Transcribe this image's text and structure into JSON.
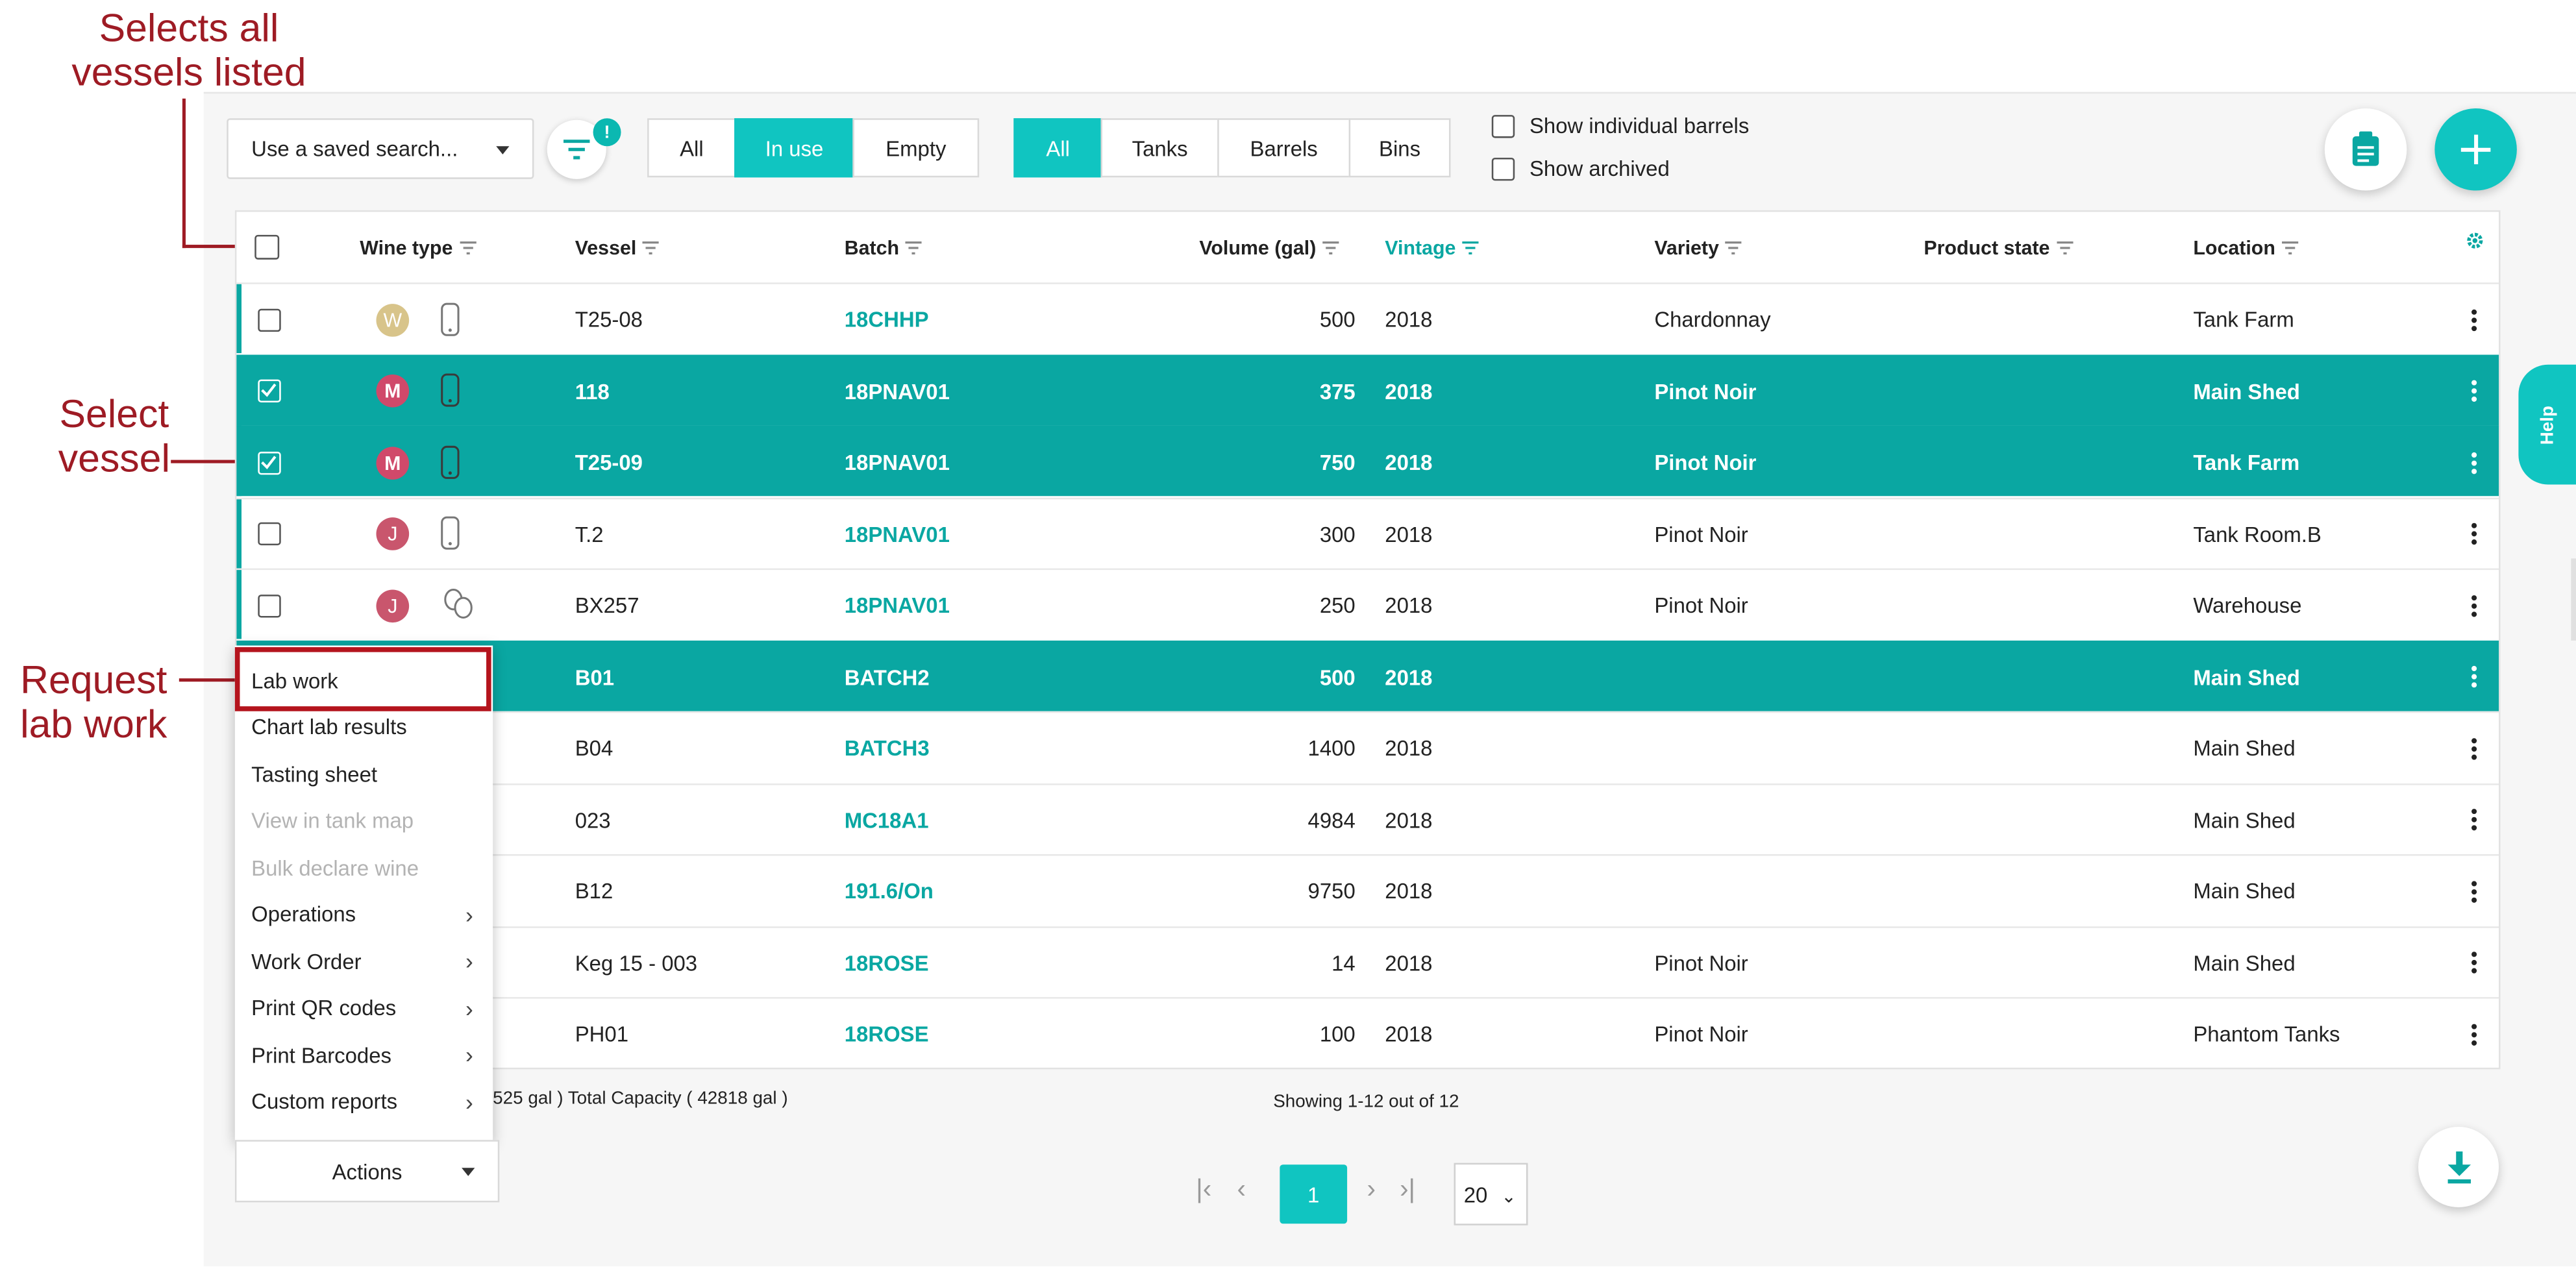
{
  "annotations": {
    "select_all": [
      "Selects all",
      "vessels listed"
    ],
    "select_vessel": [
      "Select",
      "vessel"
    ],
    "request_lab": [
      "Request",
      "lab work"
    ]
  },
  "toolbar": {
    "saved_search_placeholder": "Use a saved search...",
    "filter_badge": "!",
    "status_filter": {
      "items": [
        "All",
        "In use",
        "Empty"
      ],
      "active": "In use"
    },
    "type_filter": {
      "items": [
        "All",
        "Tanks",
        "Barrels",
        "Bins"
      ],
      "active": "All"
    },
    "show_individual_barrels": "Show individual barrels",
    "show_archived": "Show archived"
  },
  "table": {
    "columns": {
      "wine_type": "Wine type",
      "vessel": "Vessel",
      "batch": "Batch",
      "volume": "Volume (gal)",
      "vintage": "Vintage",
      "variety": "Variety",
      "product_state": "Product state",
      "location": "Location"
    },
    "rows": [
      {
        "selected": false,
        "wine": "W",
        "vessel": "T25-08",
        "batch": "18CHHP",
        "volume": "500",
        "vintage": "2018",
        "variety": "Chardonnay",
        "location": "Tank Farm"
      },
      {
        "selected": true,
        "wine": "M",
        "vessel": "118",
        "batch": "18PNAV01",
        "volume": "375",
        "vintage": "2018",
        "variety": "Pinot Noir",
        "location": "Main Shed"
      },
      {
        "selected": true,
        "wine": "M",
        "vessel": "T25-09",
        "batch": "18PNAV01",
        "volume": "750",
        "vintage": "2018",
        "variety": "Pinot Noir",
        "location": "Tank Farm"
      },
      {
        "selected": false,
        "wine": "J",
        "vessel": "T.2",
        "batch": "18PNAV01",
        "volume": "300",
        "vintage": "2018",
        "variety": "Pinot Noir",
        "location": "Tank Room.B"
      },
      {
        "selected": false,
        "wine": "J",
        "vessel": "BX257",
        "batch": "18PNAV01",
        "volume": "250",
        "vintage": "2018",
        "variety": "Pinot Noir",
        "location": "Warehouse"
      },
      {
        "selected": true,
        "wine": "",
        "vessel": "B01",
        "batch": "BATCH2",
        "volume": "500",
        "vintage": "2018",
        "variety": "",
        "location": "Main Shed"
      },
      {
        "selected": false,
        "wine": "",
        "vessel": "B04",
        "batch": "BATCH3",
        "volume": "1400",
        "vintage": "2018",
        "variety": "",
        "location": "Main Shed"
      },
      {
        "selected": false,
        "wine": "",
        "vessel": "023",
        "batch": "MC18A1",
        "volume": "4984",
        "vintage": "2018",
        "variety": "",
        "location": "Main Shed"
      },
      {
        "selected": false,
        "wine": "",
        "vessel": "B12",
        "batch": "191.6/On",
        "volume": "9750",
        "vintage": "2018",
        "variety": "",
        "location": "Main Shed"
      },
      {
        "selected": false,
        "wine": "",
        "vessel": "Keg 15 - 003",
        "batch": "18ROSE",
        "volume": "14",
        "vintage": "2018",
        "variety": "Pinot Noir",
        "location": "Main Shed"
      },
      {
        "selected": false,
        "wine": "",
        "vessel": "PH01",
        "batch": "18ROSE",
        "volume": "100",
        "vintage": "2018",
        "variety": "Pinot Noir",
        "location": "Phantom Tanks"
      }
    ]
  },
  "menu": {
    "items": [
      {
        "label": "Lab work",
        "disabled": false,
        "submenu": false
      },
      {
        "label": "Chart lab results",
        "disabled": false,
        "submenu": false
      },
      {
        "label": "Tasting sheet",
        "disabled": false,
        "submenu": false
      },
      {
        "label": "View in tank map",
        "disabled": true,
        "submenu": false
      },
      {
        "label": "Bulk declare wine",
        "disabled": true,
        "submenu": false
      },
      {
        "label": "Operations",
        "disabled": false,
        "submenu": true
      },
      {
        "label": "Work Order",
        "disabled": false,
        "submenu": true
      },
      {
        "label": "Print QR codes",
        "disabled": false,
        "submenu": true
      },
      {
        "label": "Print Barcodes",
        "disabled": false,
        "submenu": true
      },
      {
        "label": "Custom reports",
        "disabled": false,
        "submenu": true
      }
    ]
  },
  "footer": {
    "totals_fragment": "525 gal ) Total Capacity ( 42818 gal )",
    "showing": "Showing 1-12 out of 12",
    "actions_label": "Actions",
    "current_page": "1",
    "per_page": "20"
  },
  "help_label": "Help",
  "colors": {
    "teal": "#0aa7a2",
    "teal_light": "#10c5c1",
    "annotation": "#9e1b24",
    "avatar_w": "#d8c48a",
    "avatar_m": "#d0496a",
    "avatar_j": "#c9566d"
  },
  "icons": [
    "filter-icon",
    "clipboard-icon",
    "plus-icon",
    "gear-icon",
    "tank-icon",
    "barrel-icon",
    "kebab-icon",
    "download-icon",
    "help-icon",
    "chevron-right-icon",
    "first-page-icon",
    "prev-page-icon",
    "next-page-icon",
    "last-page-icon"
  ]
}
